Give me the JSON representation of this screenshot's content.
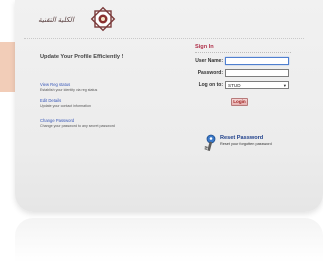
{
  "header": {
    "logo_text": "الكلية التقنية"
  },
  "left": {
    "heading": "Update Your Profile Efficiently !",
    "features": [
      {
        "title": "View Reg status",
        "description": "Establish your identity via reg status"
      },
      {
        "title": "Edit Details",
        "description": "Update your contact information"
      },
      {
        "title": "Change Password",
        "description": "Change your password to any secret password"
      }
    ]
  },
  "signin": {
    "title": "Sign In",
    "username_label": "User Name:",
    "username_value": "",
    "password_label": "Password:",
    "password_value": "",
    "logon_label": "Log on to:",
    "logon_value": "STUD",
    "login_button": "Login"
  },
  "reset": {
    "title": "Reset Password",
    "description": "Reset your forgotten password"
  },
  "colors": {
    "accent": "#b0304a",
    "link": "#3656b8",
    "reset_title": "#1e3f8a",
    "stripe": "#f2cdb8"
  },
  "icons": {
    "logo": "emblem-icon",
    "key": "key-icon",
    "dropdown": "chevron-down-icon"
  }
}
